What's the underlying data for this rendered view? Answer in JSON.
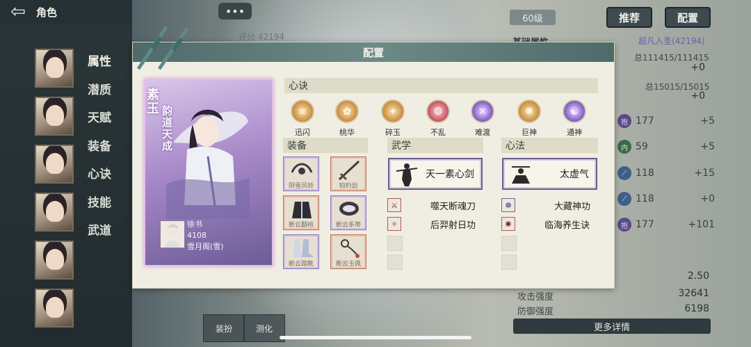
{
  "topbar": {
    "back_icon": "arrow-left-icon",
    "title": "角色"
  },
  "sidebar": {
    "menu": [
      "属性",
      "潜质",
      "天赋",
      "装备",
      "心诀",
      "技能",
      "武道"
    ],
    "avatar_count": 7
  },
  "top": {
    "more_label": "•••",
    "score_label": "评分 42194",
    "level_label": "60级",
    "recommend_label": "推荐",
    "config_label": "配置"
  },
  "stats": {
    "header": "基础属性",
    "rank": "超凡入圣(42194)",
    "hp": "总111415/111415",
    "hp_plus": "+0",
    "mp": "总15015/15015",
    "mp_plus": "+0",
    "attrs": [
      {
        "badge": "抱",
        "value": "177",
        "plus": "+5",
        "color": "purple"
      },
      {
        "badge": "内",
        "value": "59",
        "plus": "+5",
        "color": "green"
      },
      {
        "badge": "",
        "value": "118",
        "plus": "+15",
        "color": "blue"
      },
      {
        "badge": "",
        "value": "118",
        "plus": "+0",
        "color": "blue"
      },
      {
        "badge": "抱",
        "value": "177",
        "plus": "+101",
        "color": "purple"
      }
    ],
    "rows": [
      {
        "label": "",
        "value": "2.50"
      },
      {
        "label": "攻击强度",
        "value": "32641"
      },
      {
        "label": "防御强度",
        "value": "6198"
      }
    ],
    "more_details": "更多详情"
  },
  "modal": {
    "title": "配置",
    "character": {
      "name": "素玉",
      "title": "韵道天成",
      "book_name": "徐书",
      "book_level": "4108",
      "book_source": "雪月阁(雪)"
    },
    "xinjue_section": "心诀",
    "xinjue": [
      {
        "label": "迅闪",
        "glyph": "≋",
        "tone": "gold"
      },
      {
        "label": "桃华",
        "glyph": "✿",
        "tone": "gold"
      },
      {
        "label": "碎玉",
        "glyph": "✦",
        "tone": "gold"
      },
      {
        "label": "不乱",
        "glyph": "❂",
        "tone": "red"
      },
      {
        "label": "难渡",
        "glyph": "✕",
        "tone": "purple"
      },
      {
        "label": "巨神",
        "glyph": "✺",
        "tone": "gold"
      },
      {
        "label": "通神",
        "glyph": "☯",
        "tone": "purple"
      }
    ],
    "equip_section": "装备",
    "equipment": [
      {
        "label": "阴雪风铃",
        "tone": "purple"
      },
      {
        "label": "钩钓剑",
        "tone": "red"
      },
      {
        "label": "断云翻袍",
        "tone": "red"
      },
      {
        "label": "断云系带",
        "tone": "purple"
      },
      {
        "label": "断云踏靴",
        "tone": "purple"
      },
      {
        "label": "断云玉佩",
        "tone": "red"
      }
    ],
    "wuxue_section": "武学",
    "wuxue_main": "天一素心剑",
    "wuxue_subs": [
      "噬天断魂刀",
      "后羿射日功"
    ],
    "xinfa_section": "心法",
    "xinfa_main": "太虚气",
    "xinfa_subs": [
      "大藏神功",
      "临海养生诀"
    ]
  },
  "bottom": {
    "btn1": "装扮",
    "btn2": "测化"
  }
}
